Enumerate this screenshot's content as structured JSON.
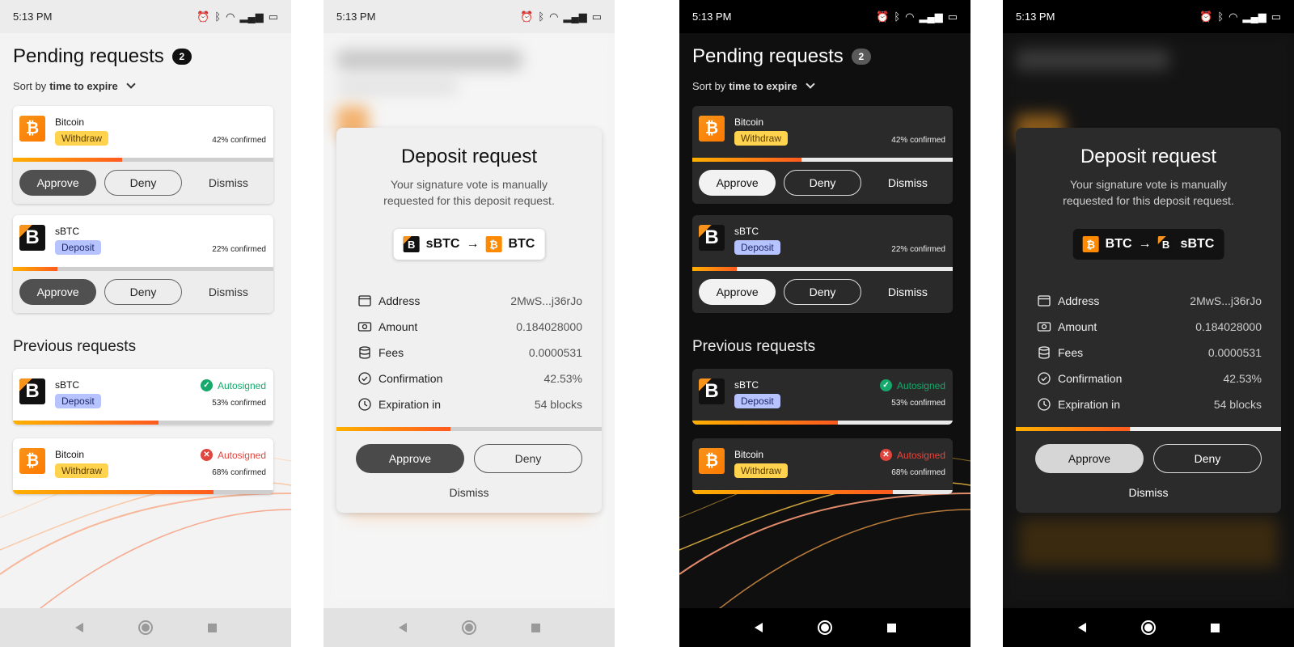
{
  "status": {
    "time": "5:13 PM"
  },
  "list": {
    "title": "Pending requests",
    "pending_count": "2",
    "sort_prefix": "Sort by",
    "sort_value": "time to expire",
    "pending": [
      {
        "coin": "Bitcoin",
        "type": "Withdraw",
        "confirmed_text": "42% confirmed",
        "progress": 0.42
      },
      {
        "coin": "sBTC",
        "type": "Deposit",
        "confirmed_text": "22% confirmed",
        "progress": 0.17
      }
    ],
    "buttons": {
      "approve": "Approve",
      "deny": "Deny",
      "dismiss": "Dismiss"
    },
    "previous_title": "Previous requests",
    "previous": [
      {
        "coin": "sBTC",
        "type": "Deposit",
        "status": "Autosigned",
        "status_kind": "success",
        "confirmed_text": "53% confirmed",
        "progress": 0.56
      },
      {
        "coin": "Bitcoin",
        "type": "Withdraw",
        "status": "Autosigned",
        "status_kind": "failed",
        "confirmed_text": "68% confirmed",
        "progress": 0.77
      }
    ]
  },
  "modal_light": {
    "title": "Deposit request",
    "subtitle": "Your signature vote is manually requested for this deposit request.",
    "from": "sBTC",
    "arrow": "→",
    "to": "BTC",
    "rows": [
      {
        "label": "Address",
        "value": "2MwS...j36rJo",
        "icon": "wallet-icon"
      },
      {
        "label": "Amount",
        "value": "0.184028000",
        "icon": "banknote-icon"
      },
      {
        "label": "Fees",
        "value": "0.0000531",
        "icon": "coins-stack-icon"
      },
      {
        "label": "Confirmation",
        "value": "42.53%",
        "icon": "check-circle-icon"
      },
      {
        "label": "Expiration in",
        "value": "54 blocks",
        "icon": "clock-icon"
      }
    ],
    "progress": 0.43,
    "approve": "Approve",
    "deny": "Deny",
    "dismiss": "Dismiss"
  },
  "modal_dark": {
    "title": "Deposit request",
    "subtitle": "Your signature vote is manually requested for this deposit request.",
    "from": "BTC",
    "arrow": "→",
    "to": "sBTC",
    "rows": [
      {
        "label": "Address",
        "value": "2MwS...j36rJo",
        "icon": "wallet-icon"
      },
      {
        "label": "Amount",
        "value": "0.184028000",
        "icon": "banknote-icon"
      },
      {
        "label": "Fees",
        "value": "0.0000531",
        "icon": "coins-stack-icon"
      },
      {
        "label": "Confirmation",
        "value": "42.53%",
        "icon": "check-circle-icon"
      },
      {
        "label": "Expiration in",
        "value": "54 blocks",
        "icon": "clock-icon"
      }
    ],
    "progress": 0.43,
    "approve": "Approve",
    "deny": "Deny",
    "dismiss": "Dismiss"
  },
  "colors": {
    "accent_start": "#ffb000",
    "accent_end": "#ff5a1f",
    "withdraw_tag": "#ffd34d",
    "deposit_tag": "#b7c3ff",
    "success": "#17a86b",
    "error": "#e0463e"
  }
}
